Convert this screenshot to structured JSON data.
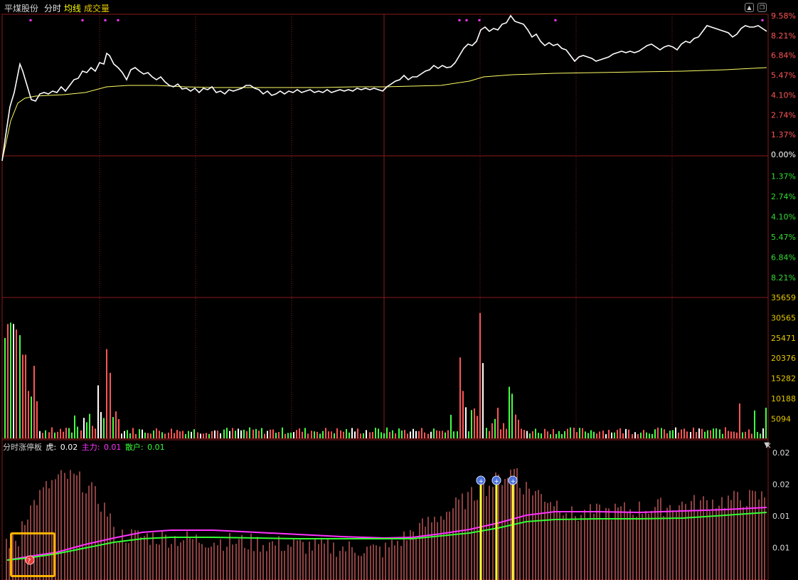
{
  "header": {
    "stock_name": "平煤股份",
    "tab_label": "分时",
    "avg_line_label": "均线",
    "volume_label": "成交量",
    "up_button_icon": "up-arrow-icon",
    "restore_button_icon": "restore-icon"
  },
  "price_axis": {
    "up_labels": [
      "9.58%",
      "8.21%",
      "6.84%",
      "5.47%",
      "4.10%",
      "2.74%",
      "1.37%",
      "0.00%"
    ],
    "down_labels": [
      "1.37%",
      "2.74%",
      "4.10%",
      "5.47%",
      "6.84%",
      "8.21%"
    ],
    "up_color": "#ff5555",
    "down_color": "#33dd33",
    "zero_color": "#ffffff"
  },
  "volume_axis": {
    "labels": [
      "35659",
      "30565",
      "25471",
      "20376",
      "15282",
      "10188",
      "5094"
    ],
    "color": "#e6c800"
  },
  "indicator": {
    "name": "分时涨停板",
    "hu_label": "虎:",
    "hu_value": "0.02",
    "zhuli_label": "主力:",
    "zhuli_value": "0.01",
    "sanhu_label": "散户:",
    "sanhu_value": "0.01",
    "axis_labels": [
      "0.02",
      "0.02",
      "0.01",
      "0.01"
    ],
    "dropdown_icon": "dropdown-triangle-icon",
    "close_icon": "close-icon"
  },
  "colors": {
    "price_line": "#ffffff",
    "avg_line": "#ffff66",
    "grid": "#8b1a1a",
    "vol_up": "#ff5555",
    "vol_down": "#44ff44",
    "vol_flat": "#ffffff",
    "zhuli_line": "#ff33ff",
    "sanhu_line": "#33ff33",
    "signal_marker": "#ff33ff",
    "highlight_box": "#ffb300"
  }
}
